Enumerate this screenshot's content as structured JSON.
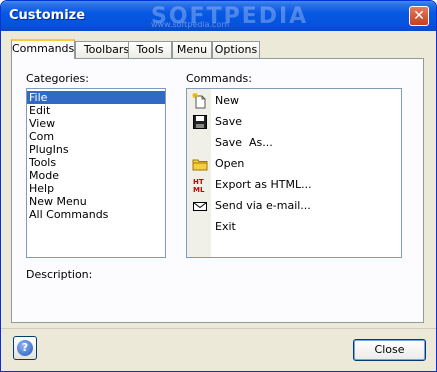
{
  "window": {
    "title": "Customize",
    "watermark": "SOFTPEDIA",
    "watermark_sub": "www.softpedia.com",
    "close_glyph": "✕"
  },
  "tabs": [
    {
      "label": "Commands",
      "active": true
    },
    {
      "label": "Toolbars",
      "active": false
    },
    {
      "label": "Tools",
      "active": false
    },
    {
      "label": "Menu",
      "active": false
    },
    {
      "label": "Options",
      "active": false
    }
  ],
  "categories": {
    "label": "Categories:",
    "items": [
      "File",
      "Edit",
      "View",
      "Com",
      "PlugIns",
      "Tools",
      "Mode",
      "Help",
      "New Menu",
      "All Commands"
    ],
    "selected": "File"
  },
  "commands": {
    "label": "Commands:",
    "items": [
      {
        "label": "New",
        "icon": "new-document-icon"
      },
      {
        "label": "Save",
        "icon": "floppy-disk-icon"
      },
      {
        "label": "Save  As...",
        "icon": ""
      },
      {
        "label": "Open",
        "icon": "folder-icon"
      },
      {
        "label": "Export as HTML...",
        "icon": "html-icon"
      },
      {
        "label": "Send via e-mail...",
        "icon": "envelope-icon"
      },
      {
        "label": "Exit",
        "icon": ""
      }
    ]
  },
  "description": {
    "label": "Description:"
  },
  "footer": {
    "help_glyph": "?",
    "close_label": "Close"
  },
  "colors": {
    "titlebar": "#0553dc",
    "selection": "#316ac5",
    "tab_highlight": "#ffc83c"
  }
}
